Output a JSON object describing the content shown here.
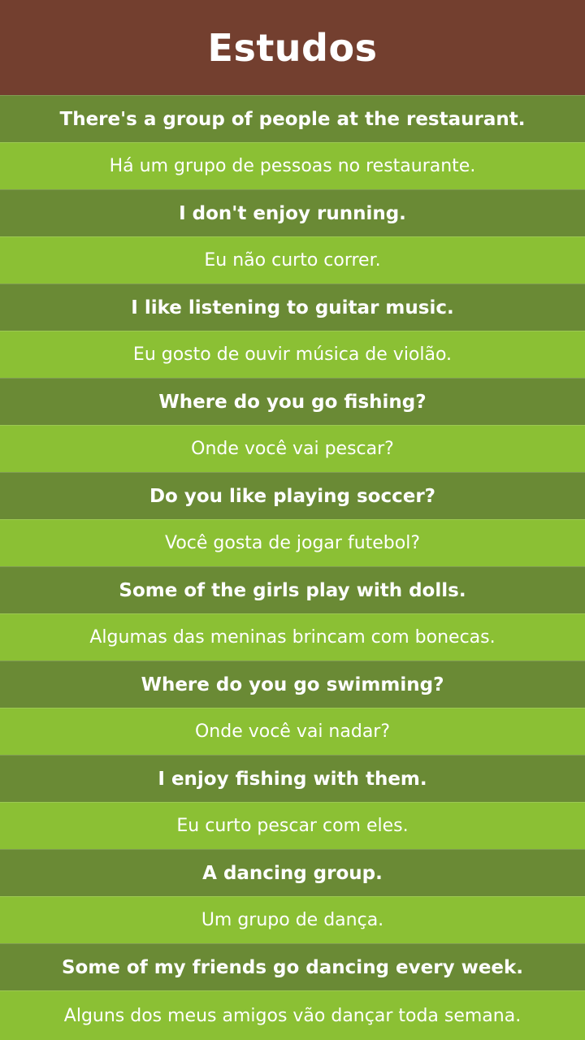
{
  "header": {
    "title": "Estudos"
  },
  "colors": {
    "header": "#733f2f",
    "english_row": "#6a8a35",
    "portuguese_row": "#8bc034",
    "text": "#ffffff"
  },
  "phrases": [
    {
      "en": "There's a group of people at the restaurant.",
      "pt": "Há um grupo de pessoas no restaurante."
    },
    {
      "en": "I don't enjoy running.",
      "pt": "Eu não curto correr."
    },
    {
      "en": "I like listening to guitar music.",
      "pt": "Eu gosto de ouvir música de violão."
    },
    {
      "en": "Where do you go fishing?",
      "pt": "Onde você vai pescar?"
    },
    {
      "en": "Do you like playing soccer?",
      "pt": "Você gosta de jogar futebol?"
    },
    {
      "en": "Some of the girls play with dolls.",
      "pt": "Algumas das meninas brincam com bonecas."
    },
    {
      "en": "Where do you go swimming?",
      "pt": "Onde você vai nadar?"
    },
    {
      "en": "I enjoy fishing with them.",
      "pt": "Eu curto pescar com eles."
    },
    {
      "en": "A dancing group.",
      "pt": "Um grupo de dança."
    },
    {
      "en": "Some of my friends go dancing every week.",
      "pt": "Alguns dos meus amigos vão dançar toda semana."
    }
  ]
}
